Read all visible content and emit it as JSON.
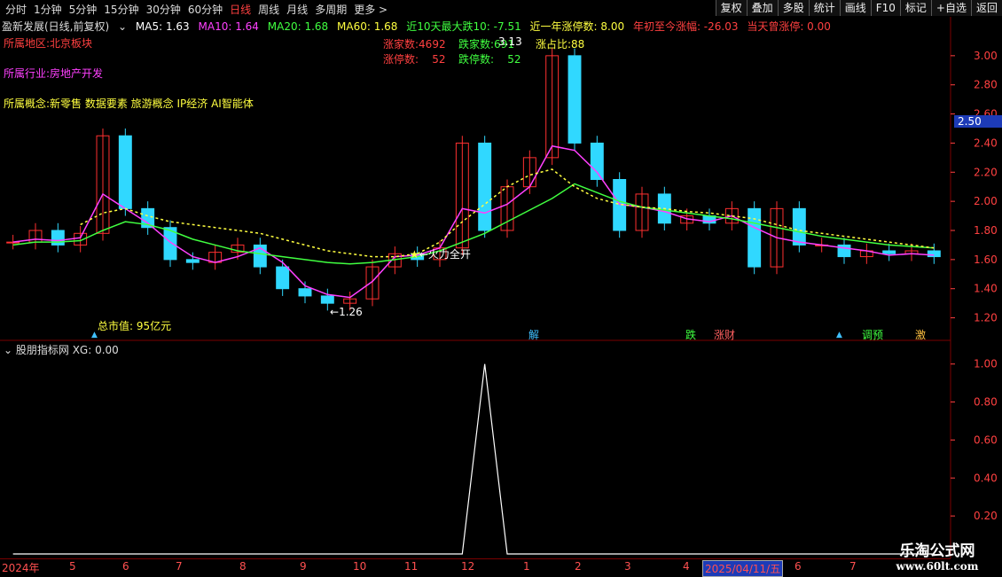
{
  "toolbar": {
    "periods": [
      "分时",
      "1分钟",
      "5分钟",
      "15分钟",
      "30分钟",
      "60分钟",
      "日线",
      "周线",
      "月线",
      "多周期",
      "更多 >"
    ],
    "active_period": "日线",
    "buttons": [
      "复权",
      "叠加",
      "多股",
      "统计",
      "画线",
      "F10",
      "标记",
      "+自选",
      "返回"
    ]
  },
  "header": {
    "title": "盈新发展(日线,前复权)",
    "ma5": "MA5: 1.63",
    "ma10": "MA10: 1.64",
    "ma20": "MA20: 1.68",
    "ma60": "MA60: 1.68",
    "drop10": "近10天最大跌10: -7.51",
    "limitup_year": "近一年涨停数: 8.00",
    "ytd": "年初至今涨幅: -26.03",
    "today_limit": "当天曾涨停: 0.00",
    "colors": {
      "ma5": "#ffffff",
      "ma10": "#ff40ff",
      "ma20": "#40ff40",
      "ma60": "#ffff40"
    }
  },
  "info": {
    "region": "所属地区:北京板块",
    "industry": "所属行业:房地产开发",
    "concepts": "所属概念:新零售 数据要素 旅游概念 IP经济 AI智能体",
    "market_cap": "总市值: 95亿元"
  },
  "stats": {
    "up_count": "涨家数:4692",
    "down_count": "跌家数:691",
    "up_ratio": "涨占比:88",
    "limit_up": "涨停数:    52",
    "limit_down": "跌停数:    52"
  },
  "annotations": {
    "high": "3.13",
    "low": "1.26",
    "signal": "火力全开"
  },
  "price_axis": {
    "ticks": [
      "3.00",
      "2.80",
      "2.60",
      "2.40",
      "2.20",
      "2.00",
      "1.80",
      "1.60",
      "1.40",
      "1.20"
    ],
    "current": "2.50",
    "range": [
      1.1,
      3.2
    ]
  },
  "event_tags": [
    {
      "text": "解",
      "color": "#40c0ff"
    },
    {
      "text": "跌",
      "color": "#40ff40"
    },
    {
      "text": "涨财",
      "color": "#ff6060"
    },
    {
      "text": "调预",
      "color": "#40ff40"
    },
    {
      "text": "激",
      "color": "#ffc040"
    }
  ],
  "sub_chart": {
    "header": "股朋指标网 XG: 0.00",
    "ticks": [
      "1.00",
      "0.80",
      "0.60",
      "0.40",
      "0.20"
    ]
  },
  "dates": {
    "labels": [
      "2024年",
      "5",
      "6",
      "7",
      "8",
      "9",
      "10",
      "11",
      "12",
      "1",
      "2",
      "3",
      "4",
      "6",
      "7"
    ],
    "selected": "2025/04/11/五"
  },
  "watermark": {
    "line1": "乐淘公式网",
    "line2": "www.60lt.com"
  },
  "chart_data": {
    "type": "line",
    "ylim": [
      1.1,
      3.2
    ],
    "series": [
      {
        "name": "MA5",
        "color": "#ff40ff",
        "values": [
          1.72,
          1.74,
          1.73,
          1.75,
          2.05,
          1.95,
          1.85,
          1.72,
          1.62,
          1.58,
          1.62,
          1.68,
          1.58,
          1.42,
          1.36,
          1.34,
          1.45,
          1.62,
          1.63,
          1.68,
          1.95,
          1.92,
          1.98,
          2.1,
          2.38,
          2.35,
          2.2,
          1.98,
          1.96,
          1.93,
          1.88,
          1.86,
          1.9,
          1.82,
          1.75,
          1.72,
          1.7,
          1.68,
          1.66,
          1.63,
          1.64,
          1.63
        ]
      },
      {
        "name": "MA20",
        "color": "#40ff40",
        "values": [
          1.7,
          1.72,
          1.72,
          1.73,
          1.8,
          1.86,
          1.84,
          1.8,
          1.74,
          1.7,
          1.66,
          1.64,
          1.62,
          1.6,
          1.58,
          1.57,
          1.58,
          1.6,
          1.62,
          1.66,
          1.72,
          1.78,
          1.86,
          1.94,
          2.02,
          2.12,
          2.06,
          2.0,
          1.96,
          1.94,
          1.92,
          1.9,
          1.88,
          1.85,
          1.82,
          1.79,
          1.76,
          1.74,
          1.72,
          1.7,
          1.69,
          1.68
        ]
      },
      {
        "name": "MA60",
        "color": "#ffff40",
        "values": [
          null,
          null,
          null,
          1.84,
          1.92,
          1.95,
          1.9,
          1.86,
          1.84,
          1.82,
          1.8,
          1.78,
          1.74,
          1.7,
          1.66,
          1.64,
          1.62,
          1.62,
          1.64,
          1.72,
          1.86,
          1.98,
          2.1,
          2.18,
          2.22,
          2.1,
          2.02,
          1.98,
          1.96,
          1.95,
          1.93,
          1.92,
          1.9,
          1.88,
          1.84,
          1.8,
          1.78,
          1.76,
          1.74,
          1.72,
          1.7,
          1.68
        ]
      }
    ],
    "xg_signal": [
      0,
      0,
      0,
      0,
      0,
      0,
      0,
      0,
      0,
      0,
      0,
      0,
      0,
      0,
      0,
      0,
      0,
      0,
      0,
      0,
      0,
      1,
      0,
      0,
      0,
      0,
      0,
      0,
      0,
      0,
      0,
      0,
      0,
      0,
      0,
      0,
      0,
      0,
      0,
      0,
      0,
      0
    ],
    "candle_closes": [
      1.72,
      1.8,
      1.7,
      1.78,
      2.45,
      1.95,
      1.82,
      1.6,
      1.58,
      1.65,
      1.7,
      1.55,
      1.4,
      1.35,
      1.3,
      1.33,
      1.55,
      1.64,
      1.6,
      1.68,
      2.4,
      1.8,
      2.1,
      2.3,
      3.0,
      2.4,
      2.15,
      1.8,
      2.05,
      1.85,
      1.9,
      1.85,
      1.95,
      1.55,
      1.95,
      1.7,
      1.7,
      1.62,
      1.66,
      1.64,
      1.66,
      1.62
    ]
  }
}
